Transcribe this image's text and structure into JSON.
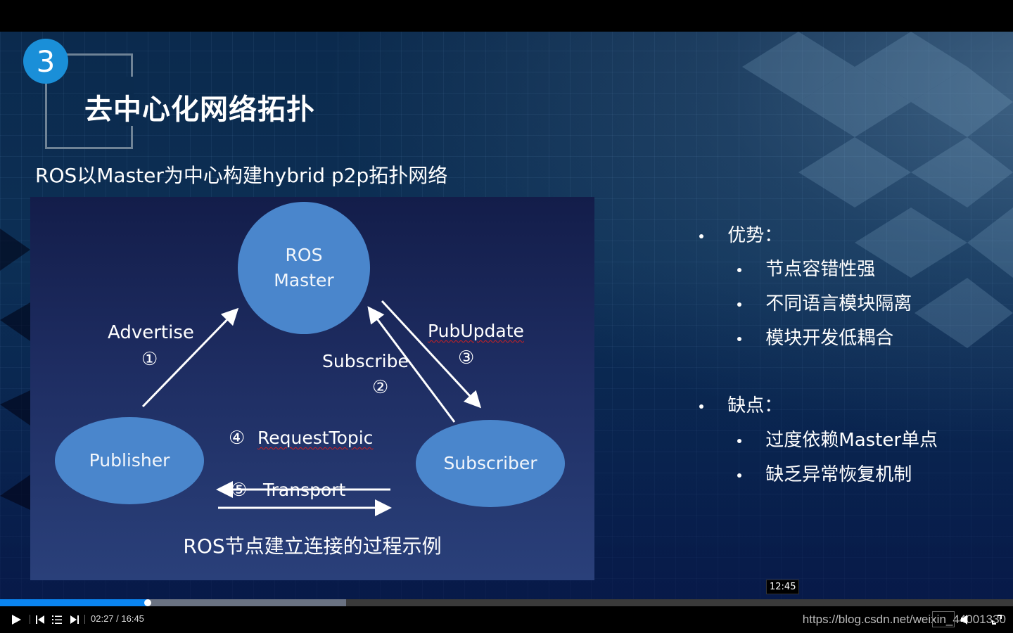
{
  "slide": {
    "section_number": "3",
    "title": "去中心化网络拓扑",
    "subtitle": "ROS以Master为中心构建hybrid p2p拓扑网络",
    "diagram": {
      "nodes": {
        "master_line1": "ROS",
        "master_line2": "Master",
        "publisher": "Publisher",
        "subscriber": "Subscriber"
      },
      "steps": [
        {
          "num": "①",
          "label": "Advertise"
        },
        {
          "num": "②",
          "label": "Subscribe"
        },
        {
          "num": "③",
          "label": "PubUpdate"
        },
        {
          "num": "④",
          "label": "RequestTopic"
        },
        {
          "num": "⑤",
          "label": "Transport"
        }
      ],
      "caption": "ROS节点建立连接的过程示例"
    },
    "pros": {
      "heading": "优势：",
      "items": [
        "节点容错性强",
        "不同语言模块隔离",
        "模块开发低耦合"
      ]
    },
    "cons": {
      "heading": "缺点：",
      "items": [
        "过度依赖Master单点",
        "缺乏异常恢复机制"
      ]
    }
  },
  "player": {
    "hover_time_tooltip": "12:45",
    "current_time": "02:27",
    "duration": "16:45",
    "time_display": "02:27 / 16:45",
    "progress_fraction": 0.146,
    "buffered_fraction": 0.342,
    "colors": {
      "played": "#0a84f0",
      "buffered": "#6a7282",
      "accent": "#1a8fd8"
    },
    "icons": [
      "play-icon",
      "previous-icon",
      "playlist-icon",
      "next-icon",
      "speed-icon",
      "volume-icon",
      "fullscreen-icon"
    ],
    "watermark": "https://blog.csdn.net/weixin_44001330"
  }
}
